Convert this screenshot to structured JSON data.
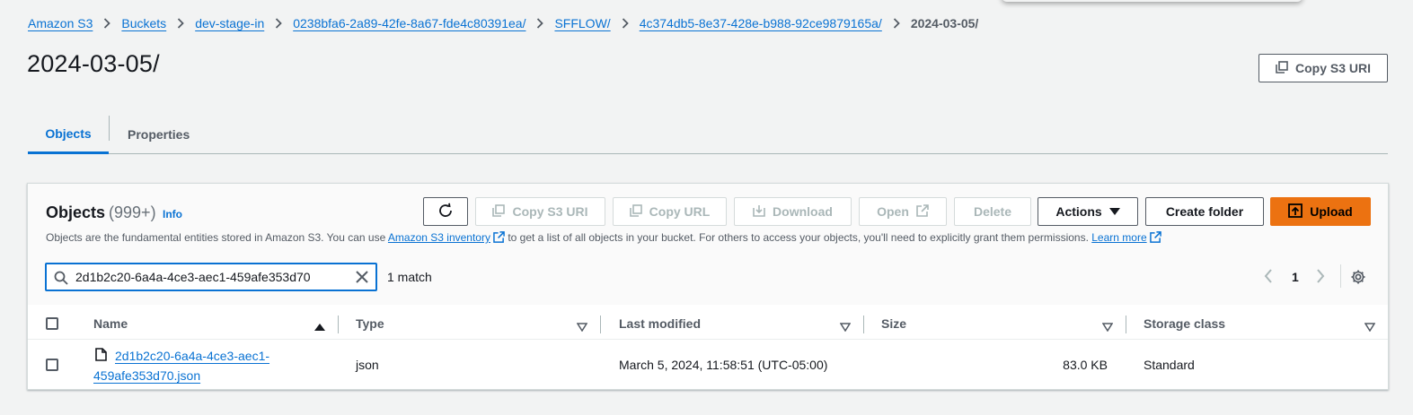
{
  "breadcrumb": {
    "items": [
      "Amazon S3",
      "Buckets",
      "dev-stage-in",
      "0238bfa6-2a89-42fe-8a67-fde4c80391ea/",
      "SFFLOW/",
      "4c374db5-8e37-428e-b988-92ce9879165a/"
    ],
    "current": "2024-03-05/"
  },
  "page": {
    "title": "2024-03-05/",
    "copy_s3_uri_label": "Copy S3 URI"
  },
  "tabs": {
    "objects": "Objects",
    "properties": "Properties"
  },
  "objects_panel": {
    "title": "Objects",
    "count": "(999+)",
    "info_label": "Info",
    "description_part1": "Objects are the fundamental entities stored in Amazon S3. You can use ",
    "inventory_link": "Amazon S3 inventory",
    "description_part2": " to get a list of all objects in your bucket. For others to access your objects, you'll need to explicitly grant them permissions. ",
    "learn_more_link": "Learn more",
    "toolbar": {
      "copy_s3_uri": "Copy S3 URI",
      "copy_url": "Copy URL",
      "download": "Download",
      "open": "Open",
      "delete": "Delete",
      "actions": "Actions",
      "create_folder": "Create folder",
      "upload": "Upload"
    },
    "search": {
      "value": "2d1b2c20-6a4a-4ce3-aec1-459afe353d70"
    },
    "match_count": "1 match",
    "pagination": {
      "current_page": "1"
    }
  },
  "table": {
    "columns": [
      "Name",
      "Type",
      "Last modified",
      "Size",
      "Storage class"
    ],
    "rows": [
      {
        "name_line1": "2d1b2c20-6a4a-4ce3-aec1-",
        "name_line2": "459afe353d70.json",
        "type": "json",
        "last_modified": "March 5, 2024, 11:58:51 (UTC-05:00)",
        "size": "83.0 KB",
        "storage_class": "Standard"
      }
    ]
  },
  "colors": {
    "link": "#0972d3",
    "primary_button": "#ec7211",
    "page_background": "#f2f3f3"
  },
  "icons": [
    "chevron-right-icon",
    "copy-icon",
    "refresh-icon",
    "download-icon",
    "external-link-icon",
    "caret-down-icon",
    "upload-icon",
    "search-icon",
    "clear-icon",
    "chevron-left-icon",
    "settings-icon",
    "sort-ascending-icon",
    "sort-icon",
    "file-icon"
  ]
}
